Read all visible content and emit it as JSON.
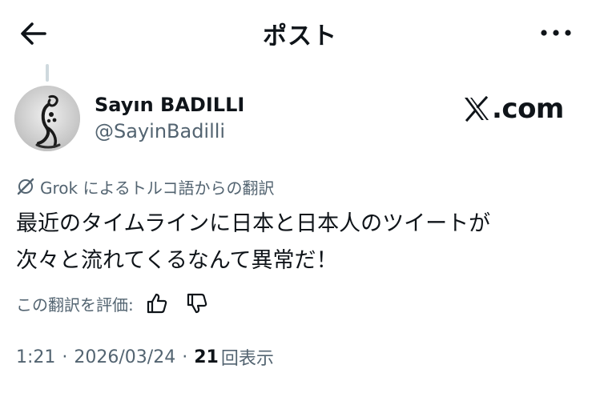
{
  "header": {
    "title": "ポスト"
  },
  "post": {
    "author": {
      "name": "Sayın BADILLI",
      "handle": "@SayinBadilli"
    },
    "source": {
      "domain": ".com"
    },
    "translation_note": "Grok によるトルコ語からの翻訳",
    "text": "最近のタイムラインに日本と日本人のツイートが\n次々と流れてくるなんて異常だ！",
    "rate_label": "この翻訳を評価:",
    "time": "1:21",
    "separator": "·",
    "date": "2026/03/24",
    "views": "21",
    "views_label": "回表示"
  },
  "colors": {
    "text": "#0f1419",
    "secondary": "#536471",
    "thread": "#cfd9de"
  },
  "icons": {
    "back": "arrow-left-icon",
    "more": "more-horizontal-icon",
    "grok": "grok-icon",
    "thumbs_up": "thumbs-up-icon",
    "thumbs_down": "thumbs-down-icon"
  }
}
